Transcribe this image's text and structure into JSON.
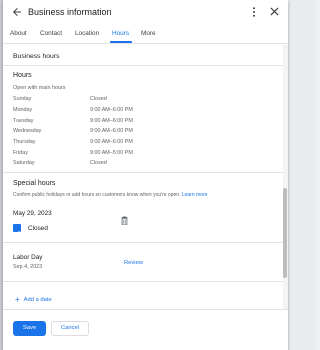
{
  "dialog": {
    "title": "Business information",
    "icons": {
      "back": "arrow-left-icon",
      "more": "more-vert-icon",
      "close": "close-icon"
    }
  },
  "tabs": [
    {
      "label": "About",
      "active": false
    },
    {
      "label": "Contact",
      "active": false
    },
    {
      "label": "Location",
      "active": false
    },
    {
      "label": "Hours",
      "active": true
    },
    {
      "label": "More",
      "active": false
    }
  ],
  "business_hours": {
    "section_title": "Business hours",
    "heading": "Hours",
    "status": "Open with main hours",
    "days": [
      {
        "day": "Sunday",
        "hours": "Closed"
      },
      {
        "day": "Monday",
        "hours": "9:00 AM–6:00 PM"
      },
      {
        "day": "Tuesday",
        "hours": "9:00 AM–6:00 PM"
      },
      {
        "day": "Wednesday",
        "hours": "9:00 AM–6:00 PM"
      },
      {
        "day": "Thursday",
        "hours": "9:00 AM–6:00 PM"
      },
      {
        "day": "Friday",
        "hours": "9:00 AM–5:00 PM"
      },
      {
        "day": "Saturday",
        "hours": "Closed"
      }
    ]
  },
  "special_hours": {
    "heading": "Special hours",
    "description": "Confirm public holidays or add hours so customers know when you're open.",
    "learn_more": "Learn more",
    "entries": [
      {
        "date": "May 29, 2023",
        "checkbox_label": "Closed",
        "checked": true
      }
    ],
    "holiday": {
      "name": "Labor Day",
      "date": "Sep 4, 2023",
      "action": "Review"
    },
    "add_date": "Add a date"
  },
  "footer": {
    "save": "Save",
    "cancel": "Cancel"
  },
  "colors": {
    "accent": "#1a73e8",
    "text": "#202124",
    "muted": "#5f6368"
  }
}
